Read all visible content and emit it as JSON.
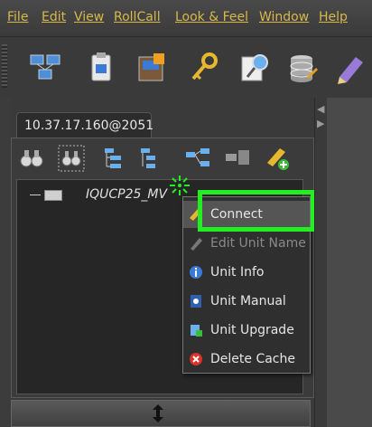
{
  "menubar": {
    "items": [
      "File",
      "Edit",
      "View",
      "RollCall",
      "Look & Feel",
      "Window",
      "Help"
    ]
  },
  "toolbar": {
    "buttons": [
      "network-icon",
      "clipboard-icon",
      "package-icon",
      "key-icon",
      "search-doc-icon",
      "database-icon",
      "edit-icon"
    ]
  },
  "tab": {
    "label": "10.37.17.160@2051"
  },
  "panel_tools": [
    "binoculars-icon",
    "binoculars-select-icon",
    "tree-expand-icon",
    "tree-collapse-icon",
    "network-link-icon",
    "network-disconnect-icon",
    "add-unit-icon"
  ],
  "tree": {
    "node_label": "IQUCP25_MV"
  },
  "context_menu": {
    "items": [
      {
        "label": "Connect",
        "icon": "connect-icon",
        "state": "active"
      },
      {
        "label": "Edit Unit Name",
        "icon": "pencil-icon",
        "state": "disabled"
      },
      {
        "label": "Unit Info",
        "icon": "info-icon",
        "state": "normal"
      },
      {
        "label": "Unit Manual",
        "icon": "manual-icon",
        "state": "normal"
      },
      {
        "label": "Unit Upgrade",
        "icon": "upgrade-icon",
        "state": "normal"
      },
      {
        "label": "Delete Cache",
        "icon": "delete-icon",
        "state": "normal"
      }
    ]
  },
  "colors": {
    "menu_text": "#d8b84a",
    "highlight": "#22ee22",
    "delete_red": "#d9332b"
  }
}
